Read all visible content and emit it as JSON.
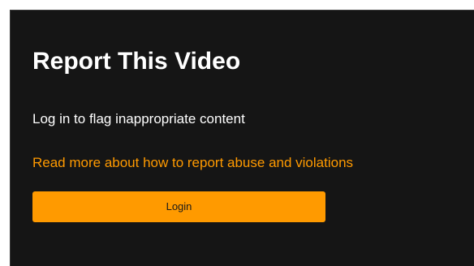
{
  "report_dialog": {
    "title": "Report This Video",
    "subtitle": "Log in to flag inappropriate content",
    "abuse_link_label": "Read more about how to report abuse and violations",
    "login_button_label": "Login"
  },
  "colors": {
    "background": "#151515",
    "accent": "#ff9a00",
    "text": "#ffffff"
  }
}
